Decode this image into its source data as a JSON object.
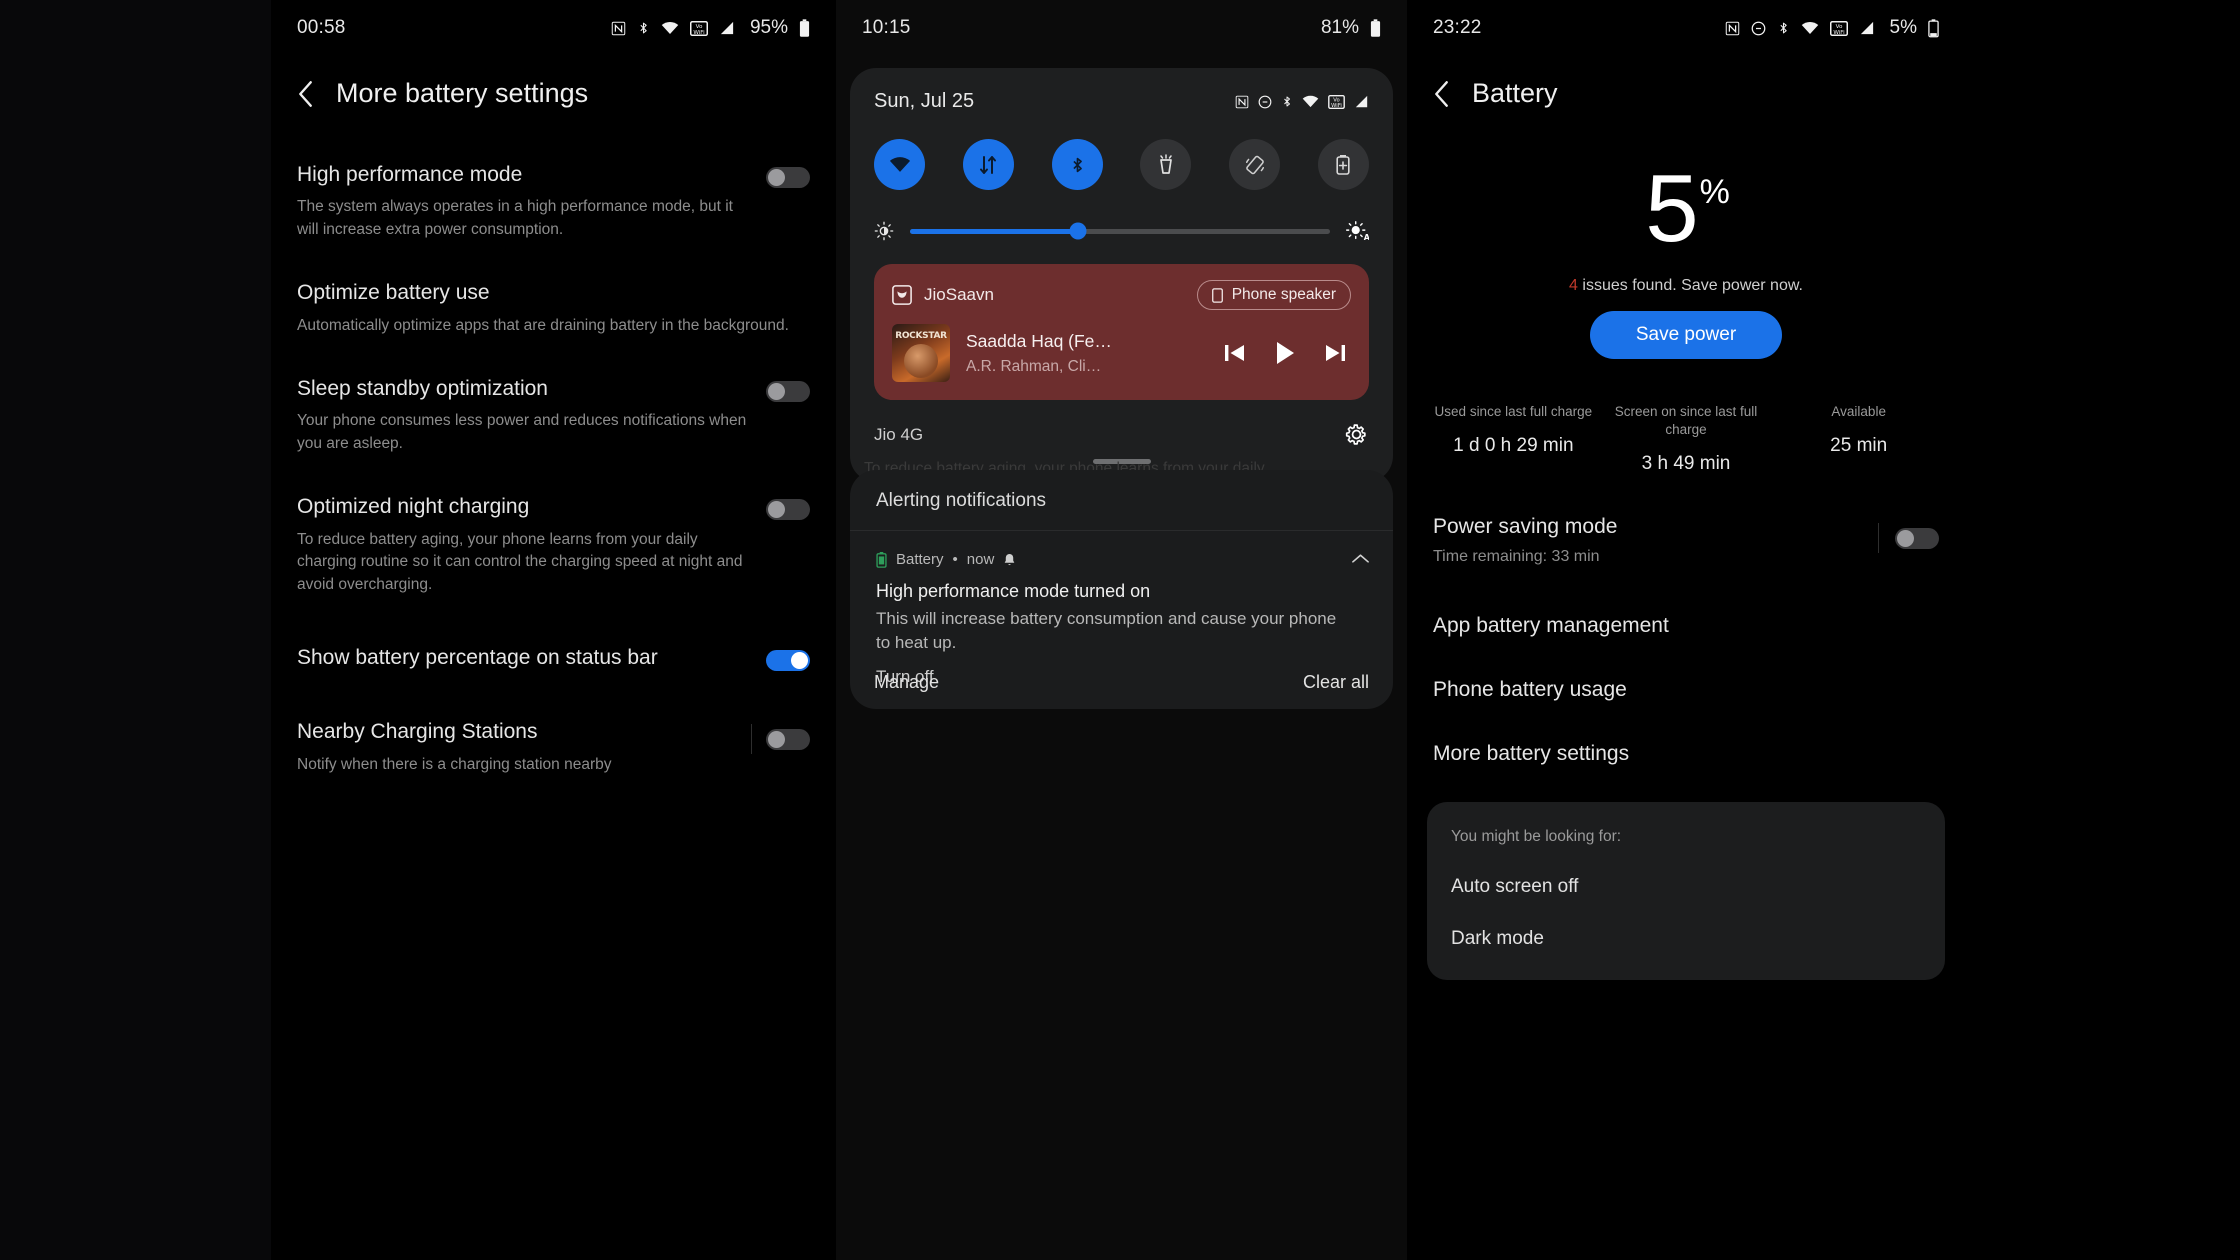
{
  "left_panel": {
    "status": {
      "clock": "00:58",
      "battery_percent": "95%",
      "icons": [
        "nfc-icon",
        "bluetooth-icon",
        "wifi-icon",
        "vowifi-icon",
        "signal-icon",
        "battery-icon"
      ]
    },
    "header": {
      "back_label": "back-arrow",
      "title": "More battery settings"
    },
    "settings": [
      {
        "title": "High performance mode",
        "desc": "The system always operates in a high performance mode, but it will increase extra power consumption.",
        "toggle": "off",
        "divider": false
      },
      {
        "title": "Optimize battery use",
        "desc": "Automatically optimize apps that are draining battery in the background.",
        "toggle": "none",
        "divider": false
      },
      {
        "title": "Sleep standby optimization",
        "desc": "Your phone consumes less power and reduces notifications when you are asleep.",
        "toggle": "off",
        "divider": false
      },
      {
        "title": "Optimized night charging",
        "desc": "To reduce battery aging, your phone learns from your daily charging routine so it can control the charging speed at night and avoid overcharging.",
        "toggle": "off",
        "divider": false
      },
      {
        "title": "Show battery percentage on status bar",
        "desc": "",
        "toggle": "on",
        "divider": false
      },
      {
        "title": "Nearby Charging Stations",
        "desc": "Notify when there is a charging station nearby",
        "toggle": "off",
        "divider": true
      }
    ]
  },
  "mid_panel": {
    "status": {
      "clock": "10:15",
      "battery_percent": "81%",
      "icons": [
        "nfc-icon",
        "bluetooth-icon",
        "wifi-icon",
        "vowifi-icon",
        "signal-icon",
        "battery-icon"
      ]
    },
    "quick_settings": {
      "date": "Sun, Jul 25",
      "status_icons": [
        "nfc-icon",
        "dnd-icon",
        "bluetooth-icon",
        "wifi-icon",
        "vowifi-icon",
        "signal-icon"
      ],
      "tiles": [
        {
          "name": "wifi-tile",
          "icon": "wifi-icon",
          "state": "on"
        },
        {
          "name": "mobile-data-tile",
          "icon": "data-arrows-icon",
          "state": "on"
        },
        {
          "name": "bluetooth-tile",
          "icon": "bluetooth-icon",
          "state": "on"
        },
        {
          "name": "flashlight-tile",
          "icon": "flashlight-icon",
          "state": "off"
        },
        {
          "name": "auto-rotate-tile",
          "icon": "rotate-icon",
          "state": "off"
        },
        {
          "name": "battery-saver-tile",
          "icon": "battery-plus-icon",
          "state": "off"
        }
      ],
      "brightness": {
        "value_percent": 40,
        "left_icon": "brightness-low-icon",
        "right_icon": "brightness-auto-icon"
      },
      "media": {
        "app_name": "JioSaavn",
        "app_icon": "jiosaavn-icon",
        "output_chip": {
          "label": "Phone speaker",
          "icon": "phone-speaker-icon"
        },
        "album_art_text": "ROCKSTAR",
        "track_title": "Saadda Haq (Fe…",
        "track_artist": "A.R. Rahman, Cli…",
        "controls": [
          "previous-icon",
          "play-icon",
          "next-icon"
        ]
      },
      "carrier": "Jio 4G",
      "settings_icon": "gear-icon"
    },
    "ghost_text": "To reduce battery aging, your phone learns from your daily",
    "notifications": {
      "section_title": "Alerting notifications",
      "item": {
        "app_icon": "battery-icon",
        "app_name": "Battery",
        "time": "now",
        "bell_icon": "bell-icon",
        "title": "High performance mode turned on",
        "text": "This will increase battery consumption and cause your phone to heat up.",
        "action": "Turn off",
        "collapse_icon": "chevron-up-icon"
      },
      "footer": {
        "manage": "Manage",
        "clear_all": "Clear all"
      }
    }
  },
  "right_panel": {
    "status": {
      "clock": "23:22",
      "battery_percent": "5%",
      "icons": [
        "nfc-icon",
        "dnd-icon",
        "bluetooth-icon",
        "wifi-icon",
        "vowifi-icon",
        "signal-icon",
        "battery-icon"
      ]
    },
    "header": {
      "back_label": "back-arrow",
      "title": "Battery"
    },
    "percent_value": "5",
    "percent_symbol": "%",
    "issues_count": "4",
    "issues_text": "issues found. Save power now.",
    "save_power_button": "Save power",
    "stats": [
      {
        "label": "Used since last full charge",
        "value": "1 d 0 h 29 min"
      },
      {
        "label": "Screen on since last full charge",
        "value": "3 h 49 min"
      },
      {
        "label": "Available",
        "value": "25 min"
      }
    ],
    "items": [
      {
        "title": "Power saving mode",
        "sub": "Time remaining:  33 min",
        "toggle": "off",
        "divider": true
      },
      {
        "title": "App battery management",
        "sub": "",
        "toggle": "none",
        "divider": false
      },
      {
        "title": "Phone battery usage",
        "sub": "",
        "toggle": "none",
        "divider": false
      },
      {
        "title": "More battery settings",
        "sub": "",
        "toggle": "none",
        "divider": false
      }
    ],
    "hint_card": {
      "head": "You might be looking for:",
      "items": [
        "Auto screen off",
        "Dark mode"
      ]
    }
  },
  "colors": {
    "accent": "#1b72e8",
    "media_bg": "#6d2e2e",
    "card_bg": "#1e1f20",
    "warn": "#c0392b"
  }
}
